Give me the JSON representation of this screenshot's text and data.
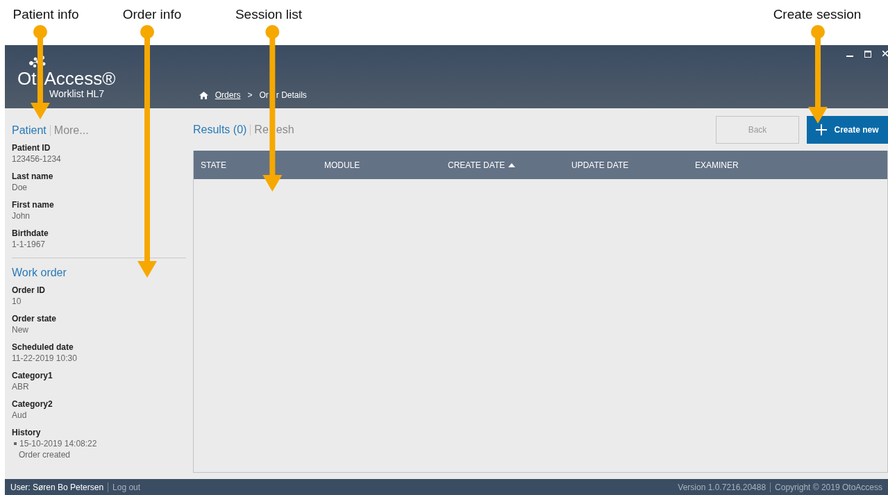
{
  "annotations": [
    {
      "label": "Patient info"
    },
    {
      "label": "Order info"
    },
    {
      "label": "Session list"
    },
    {
      "label": "Create session"
    }
  ],
  "app": {
    "logo": [
      "Ot",
      "Access®"
    ],
    "subtitle": "Worklist HL7"
  },
  "breadcrumb": [
    {
      "label": [
        "Orders"
      ],
      "link": true
    },
    {
      "label": [
        ">"
      ],
      "link": false
    },
    {
      "label": [
        "Or",
        "r Details"
      ],
      "link": false
    }
  ],
  "sidebar": {
    "tabs": [
      {
        "label": "Patient",
        "selected": true
      },
      {
        "label": "More...",
        "selected": false
      }
    ],
    "patient_fields": [
      {
        "label": "Patient ID",
        "value": "123456-1234"
      },
      {
        "label": "Last name",
        "value": "Doe"
      },
      {
        "label": "First name",
        "value": "John"
      },
      {
        "label": "Birthdate",
        "value": "1-1-1967"
      }
    ],
    "work_order_title": "Work order",
    "order_fields": [
      {
        "label": "Order ID",
        "value": "10"
      },
      {
        "label": "Order state",
        "value": "New"
      },
      {
        "label": "Scheduled date",
        "value": "11-22-2019 10:30"
      },
      {
        "label": "Category1",
        "value": "ABR"
      },
      {
        "label": "Category2",
        "value": "Aud"
      }
    ],
    "history": {
      "label": "History",
      "entries": [
        {
          "time": "15-10-2019 14:08:22",
          "text": "Order created"
        }
      ]
    }
  },
  "results": {
    "tabs": [
      {
        "label": [
          "Results (0)"
        ],
        "selected": true
      },
      {
        "label": [
          "Re",
          "esh"
        ],
        "selected": false
      }
    ],
    "buttons": [
      {
        "label": "Back",
        "kind": "secondary",
        "disabled": true
      },
      {
        "label": "Create new",
        "kind": "primary",
        "disabled": false
      }
    ],
    "table": {
      "columns": [
        {
          "label": "STATE",
          "sorted": false
        },
        {
          "label": "MODULE",
          "sorted": false
        },
        {
          "label": "CREATE DATE",
          "sorted": true
        },
        {
          "label": "UPDATE DATE",
          "sorted": false
        },
        {
          "label": "EXAMINER",
          "sorted": false
        }
      ]
    }
  },
  "status_bar": {
    "user": "User: Søren Bo Petersen",
    "logout": "Log out",
    "version": "Version 1.0.7216.20488",
    "copyright": "Copyright © 2019 OtoAccess"
  }
}
